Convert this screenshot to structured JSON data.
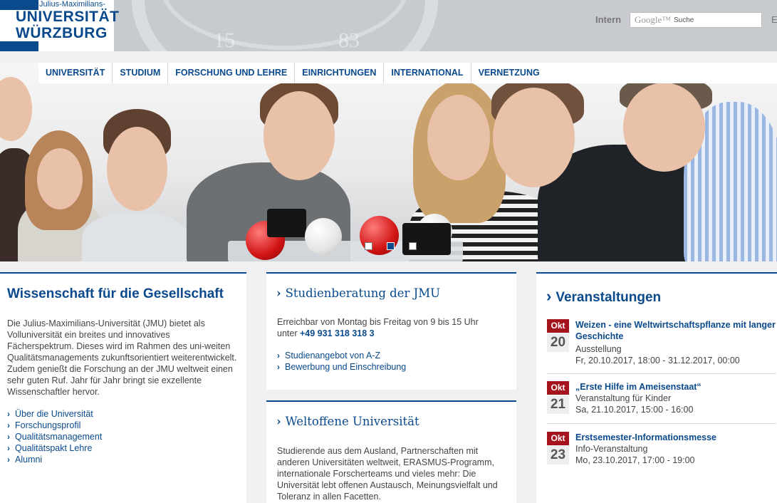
{
  "header": {
    "logo_line1": "Julius-Maximilians-",
    "logo_line2": "UNIVERSITÄT",
    "logo_line3": "WÜRZBURG",
    "seal_left": "15",
    "seal_right": "83",
    "intern_label": "Intern",
    "search_brand": "Google™",
    "search_placeholder": "Suche",
    "lang_label": "E"
  },
  "nav": {
    "items": [
      "UNIVERSITÄT",
      "STUDIUM",
      "FORSCHUNG UND LEHRE",
      "EINRICHTUNGEN",
      "INTERNATIONAL",
      "VERNETZUNG"
    ]
  },
  "slider": {
    "slides": 3,
    "active": 2
  },
  "left": {
    "title": "Wissenschaft für die Gesellschaft",
    "text": "Die Julius-Maximilians-Universität (JMU) bietet als Volluniversität ein breites und innovatives Fächerspektrum. Dieses wird im Rahmen des uni-weiten Qualitätsmanagements zukunftsorientiert weiterentwickelt. Zudem genießt die Forschung an der JMU weltweit einen sehr guten Ruf. Jahr für Jahr bringt sie exzellente Wissenschaftler hervor.",
    "links": [
      "Über die Universität",
      "Forschungsprofil",
      "Qualitätsmanagement",
      "Qualitätspakt Lehre",
      "Alumni"
    ]
  },
  "mid1": {
    "title": "Studienberatung der JMU",
    "text_line1": "Erreichbar von Montag bis Freitag von 9 bis 15 Uhr",
    "text_prefix": "unter",
    "phone": "+49 931 318 318 3",
    "links": [
      "Studienangebot von A-Z",
      "Bewerbung und Einschreibung"
    ]
  },
  "mid2": {
    "title": "Weltoffene Universität",
    "text": "Studierende aus dem Ausland, Partnerschaften mit anderen Universitäten weltweit, ERASMUS-Programm, internationale Forscherteams und vieles mehr: Die Universität lebt offenen Austausch, Meinungsvielfalt und Toleranz in allen Facetten."
  },
  "events": {
    "title": "Veranstaltungen",
    "items": [
      {
        "month": "Okt",
        "day": "20",
        "title": "Weizen - eine Weltwirtschaftspflanze mit langer Geschichte",
        "type": "Ausstellung",
        "date": "Fr, 20.10.2017, 18:00 - 31.12.2017, 00:00"
      },
      {
        "month": "Okt",
        "day": "21",
        "title": "„Erste Hilfe im Ameisenstaat“",
        "type": "Veranstaltung für Kinder",
        "date": "Sa, 21.10.2017, 15:00 - 16:00"
      },
      {
        "month": "Okt",
        "day": "23",
        "title": "Erstsemester-Informationsmesse",
        "type": "Info-Veranstaltung",
        "date": "Mo, 23.10.2017, 17:00 - 19:00"
      }
    ]
  },
  "colors": {
    "brand_blue": "#0a4a8c",
    "event_red": "#a5141d",
    "header_grey": "#c7cbcf"
  }
}
